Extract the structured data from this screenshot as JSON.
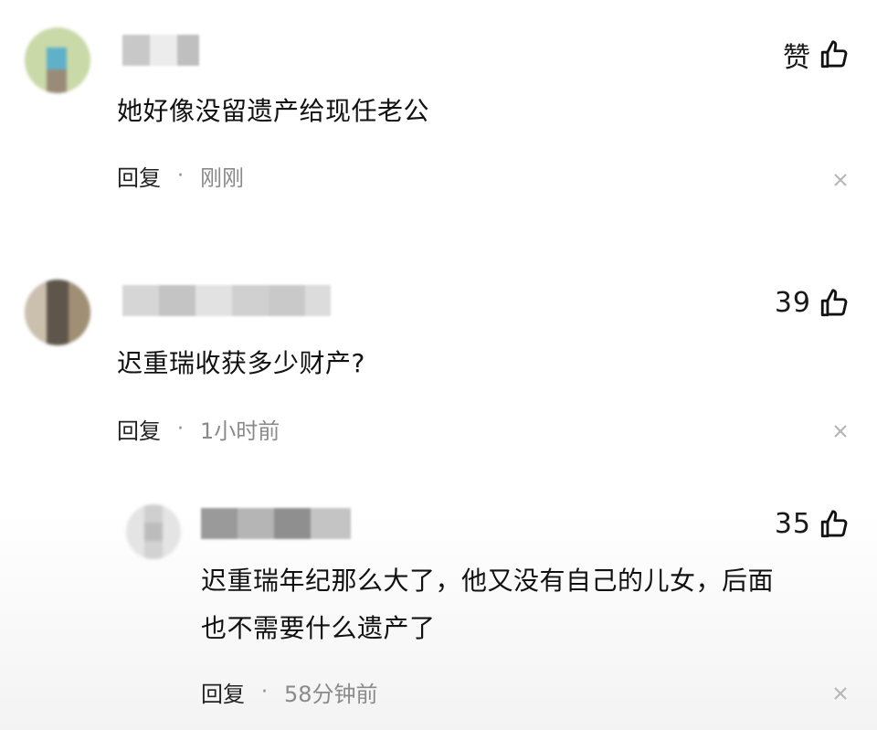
{
  "comments": [
    {
      "like_label": "赞",
      "text": "她好像没留遗产给现任老公",
      "reply_label": "回复",
      "time": "刚刚"
    },
    {
      "like_label": "39",
      "text": "迟重瑞收获多少财产?",
      "reply_label": "回复",
      "time": "1小时前"
    },
    {
      "like_label": "35",
      "text_line1": "迟重瑞年纪那么大了，他又没有自己的儿女，后面",
      "text_line2": "也不需要什么遗产了",
      "reply_label": "回复",
      "time": "58分钟前"
    }
  ],
  "separator": "·",
  "icons": {
    "like": "thumbs-up-icon",
    "close": "close-icon"
  },
  "colors": {
    "text": "#111111",
    "muted": "#8a8a8a"
  }
}
